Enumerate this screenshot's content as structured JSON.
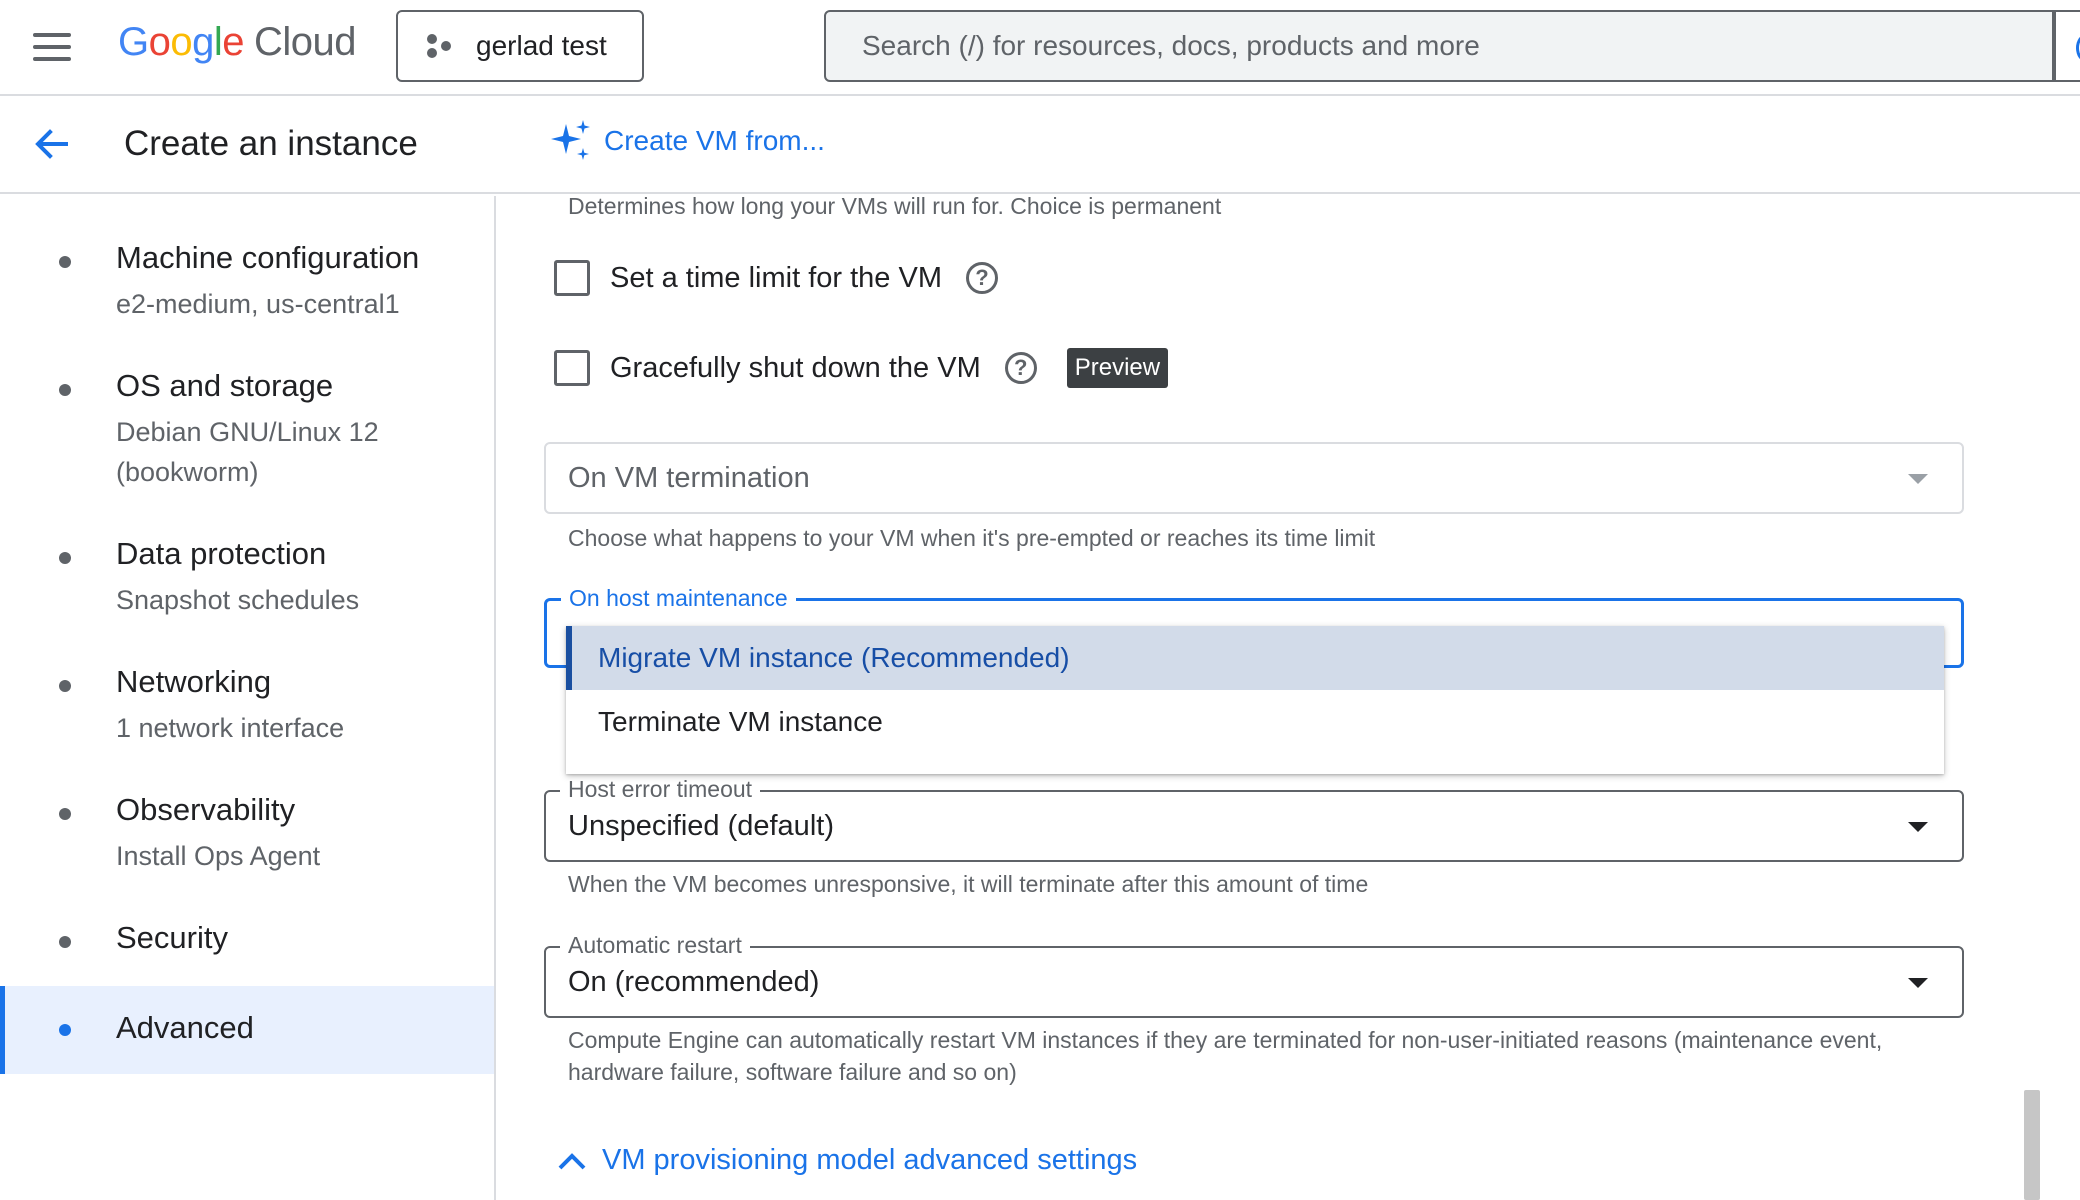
{
  "header": {
    "logo_google": [
      "G",
      "o",
      "o",
      "g",
      "l",
      "e"
    ],
    "logo_cloud": "Cloud",
    "project_name": "gerlad test",
    "search_placeholder": "Search (/) for resources, docs, products and more"
  },
  "subheader": {
    "title": "Create an instance",
    "create_from_label": "Create VM from..."
  },
  "nav": {
    "items": [
      {
        "title": "Machine configuration",
        "subtitle": "e2-medium, us-central1"
      },
      {
        "title": "OS and storage",
        "subtitle": "Debian GNU/Linux 12 (bookworm)"
      },
      {
        "title": "Data protection",
        "subtitle": "Snapshot schedules"
      },
      {
        "title": "Networking",
        "subtitle": "1 network interface"
      },
      {
        "title": "Observability",
        "subtitle": "Install Ops Agent"
      },
      {
        "title": "Security",
        "subtitle": ""
      },
      {
        "title": "Advanced",
        "subtitle": ""
      }
    ],
    "active_index": 6
  },
  "main": {
    "provisioning_hint": "Determines how long your VMs will run for. Choice is permanent",
    "time_limit_label": "Set a time limit for the VM",
    "graceful_label": "Gracefully shut down the VM",
    "preview_badge": "Preview",
    "help_glyph": "?",
    "on_termination": {
      "value": "On VM termination",
      "hint": "Choose what happens to your VM when it's pre-empted or reaches its time limit"
    },
    "host_maintenance": {
      "label": "On host maintenance",
      "options": [
        "Migrate VM instance (Recommended)",
        "Terminate VM instance"
      ],
      "selected": "Migrate VM instance (Recommended)"
    },
    "host_error_timeout": {
      "label": "Host error timeout",
      "value": "Unspecified (default)",
      "hint": "When the VM becomes unresponsive, it will terminate after this amount of time"
    },
    "automatic_restart": {
      "label": "Automatic restart",
      "value": "On (recommended)",
      "hint": "Compute Engine can automatically restart VM instances if they are terminated for non-user-initiated reasons (maintenance event, hardware failure, software failure and so on)"
    },
    "advanced_settings_label": "VM provisioning model advanced settings"
  },
  "colors": {
    "accent": "#1a73e8",
    "active_nav_bg": "#e8f0fe",
    "selected_option_bg": "#d2dbe9",
    "badge_bg": "#3c4043"
  }
}
